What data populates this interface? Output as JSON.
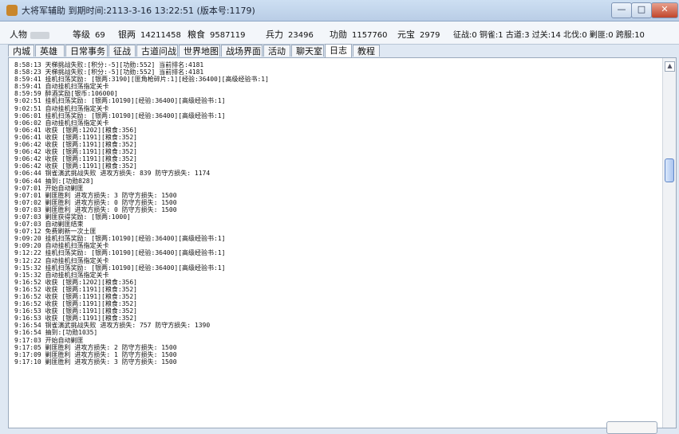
{
  "window": {
    "title": "大将军辅助 到期时间:2113-3-16 13:22:51 (版本号:1179)"
  },
  "stats": {
    "person_label": "人物",
    "level_label": "等级",
    "level": "69",
    "silver_label": "银两",
    "silver": "14211458",
    "food_label": "粮食",
    "food": "9587119",
    "troops_label": "兵力",
    "troops": "23496",
    "merit_label": "功勋",
    "merit": "1157760",
    "gold_label": "元宝",
    "gold": "2979",
    "progress": "征战:0 铜雀:1 古道:3 过关:14 北伐:0 剿匪:0 跨服:10"
  },
  "tabs": [
    "内城",
    "英雄",
    "日常事务",
    "征战",
    "古道问战",
    "世界地图",
    "战场界面",
    "活动",
    "聊天室",
    "日志",
    "教程"
  ],
  "active_tab": "日志",
  "log_lines": [
    "8:58:13 天梯挑战失败:[积分:-5][功勋:552] 当前排名:4181",
    "8:58:23 天梯挑战失败:[积分:-5][功勋:552] 当前排名:4181",
    "8:59:41 挂机扫荡奖励: [银两:3190][匪角枪碎片:1][经验:36400][高级经验书:1]",
    "8:59:41 自动挂机扫荡指定关卡",
    "8:59:59 醉酒奖励[银币:106000]",
    "9:02:51 挂机扫荡奖励: [银两:10190][经验:36400][高级经验书:1]",
    "9:02:51 自动挂机扫荡指定关卡",
    "9:06:01 挂机扫荡奖励: [银两:10190][经验:36400][高级经验书:1]",
    "9:06:02 自动挂机扫荡指定关卡",
    "9:06:41 收获 [银两:1202][粮食:356]",
    "9:06:41 收获 [银两:1191][粮食:352]",
    "9:06:42 收获 [银两:1191][粮食:352]",
    "9:06:42 收获 [银两:1191][粮食:352]",
    "9:06:42 收获 [银两:1191][粮食:352]",
    "9:06:42 收获 [银两:1191][粮食:352]",
    "9:06:44 铜雀演武挑战失败 进攻方损失: 839 防守方损失: 1174",
    "9:06:44 抽到:[功勋828]",
    "9:07:01 开始自动剿匪",
    "9:07:01 剿匪胜利 进攻方损失: 3 防守方损失: 1500",
    "9:07:02 剿匪胜利 进攻方损失: 0 防守方损失: 1500",
    "9:07:03 剿匪胜利 进攻方损失: 0 防守方损失: 1500",
    "9:07:03 剿匪获得奖励: [银两:1000]",
    "9:07:03 自动剿匪结束",
    "9:07:12 免费刷新一次土匪",
    "9:09:20 挂机扫荡奖励: [银两:10190][经验:36400][高级经验书:1]",
    "9:09:20 自动挂机扫荡指定关卡",
    "9:12:22 挂机扫荡奖励: [银两:10190][经验:36400][高级经验书:1]",
    "9:12:22 自动挂机扫荡指定关卡",
    "9:15:32 挂机扫荡奖励: [银两:10190][经验:36400][高级经验书:1]",
    "9:15:32 自动挂机扫荡指定关卡",
    "9:16:52 收获 [银两:1202][粮食:356]",
    "9:16:52 收获 [银两:1191][粮食:352]",
    "9:16:52 收获 [银两:1191][粮食:352]",
    "9:16:52 收获 [银两:1191][粮食:352]",
    "9:16:53 收获 [银两:1191][粮食:352]",
    "9:16:53 收获 [银两:1191][粮食:352]",
    "9:16:54 铜雀演武挑战失败 进攻方损失: 757 防守方损失: 1390",
    "9:16:54 抽到:[功勋1035]",
    "9:17:03 开始自动剿匪",
    "9:17:05 剿匪胜利 进攻方损失: 2 防守方损失: 1500",
    "9:17:09 剿匪胜利 进攻方损失: 1 防守方损失: 1500",
    "9:17:10 剿匪胜利 进攻方损失: 3 防守方损失: 1500"
  ]
}
